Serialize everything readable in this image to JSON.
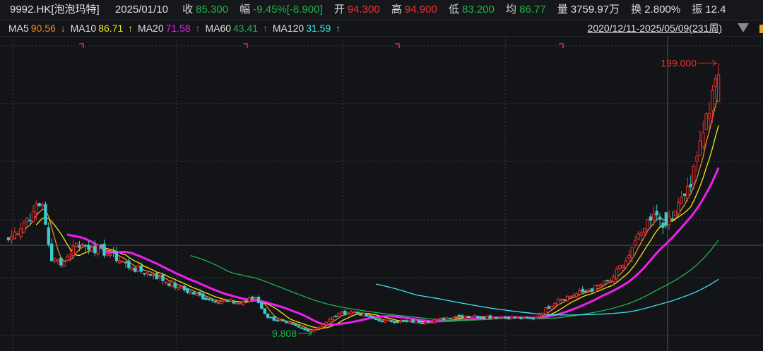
{
  "header": {
    "symbol": "9992.HK[泡泡玛特]",
    "date": "2025/01/10",
    "close_label": "收",
    "close": "85.300",
    "change_label": "幅",
    "change": "-9.45%[-8.900]",
    "open_label": "开",
    "open": "94.300",
    "high_label": "高",
    "high": "94.900",
    "low_label": "低",
    "low": "83.200",
    "avg_label": "均",
    "avg": "86.77",
    "volume_label": "量",
    "volume": "3759.97万",
    "turnover_label": "换",
    "turnover": "2.800%",
    "amplitude_label": "振",
    "amplitude": "12.4"
  },
  "ma_bar": {
    "items": [
      {
        "name": "MA5",
        "value": "90.56",
        "arrow": "↓",
        "color": "#f08a24"
      },
      {
        "name": "MA10",
        "value": "86.71",
        "arrow": "↑",
        "color": "#f5e614"
      },
      {
        "name": "MA20",
        "value": "71.58",
        "arrow": "↑",
        "color": "#ee1fee"
      },
      {
        "name": "MA60",
        "value": "43.41",
        "arrow": "↑",
        "color": "#1fb24a"
      },
      {
        "name": "MA120",
        "value": "31.59",
        "arrow": "↑",
        "color": "#3fe0e8"
      }
    ],
    "range": "2020/12/11-2025/05/09(231周)"
  },
  "chart_data": {
    "type": "candlestick",
    "period": "weekly",
    "weeks": 231,
    "ylim": [
      9.8,
      199
    ],
    "up_color": "#e8322e",
    "down_color": "#3cc8cc",
    "close_keypoints": [
      [
        0,
        75.4
      ],
      [
        8,
        95
      ],
      [
        11,
        100
      ],
      [
        14,
        60.6
      ],
      [
        18,
        60
      ],
      [
        22,
        73
      ],
      [
        27,
        70
      ],
      [
        33,
        65.5
      ],
      [
        40,
        55.6
      ],
      [
        47,
        50.7
      ],
      [
        55,
        41.9
      ],
      [
        65,
        33.5
      ],
      [
        75,
        31
      ],
      [
        80,
        35
      ],
      [
        84,
        21
      ],
      [
        90,
        17.2
      ],
      [
        97,
        11.3
      ],
      [
        100,
        13.7
      ],
      [
        107,
        23.6
      ],
      [
        112,
        25
      ],
      [
        120,
        18.7
      ],
      [
        135,
        17.7
      ],
      [
        145,
        22
      ],
      [
        160,
        21
      ],
      [
        170,
        20
      ],
      [
        178,
        33.5
      ],
      [
        188,
        40
      ],
      [
        195,
        46.8
      ],
      [
        200,
        60.6
      ],
      [
        205,
        80.3
      ],
      [
        210,
        92.7
      ],
      [
        213,
        85.3
      ],
      [
        215,
        90
      ],
      [
        218,
        105
      ],
      [
        221,
        112.4
      ],
      [
        224,
        144.5
      ],
      [
        227,
        164
      ],
      [
        229,
        188
      ],
      [
        230,
        191
      ]
    ],
    "hover": {
      "week": 213,
      "open": 94.3,
      "high": 94.9,
      "low": 83.2,
      "close": 85.3
    },
    "max_label": "199.000",
    "min_label": "9.808",
    "max_value": 199.0,
    "min_value": 9.808,
    "min_week": 99,
    "ma_periods": [
      5,
      10,
      20,
      60,
      120
    ]
  }
}
